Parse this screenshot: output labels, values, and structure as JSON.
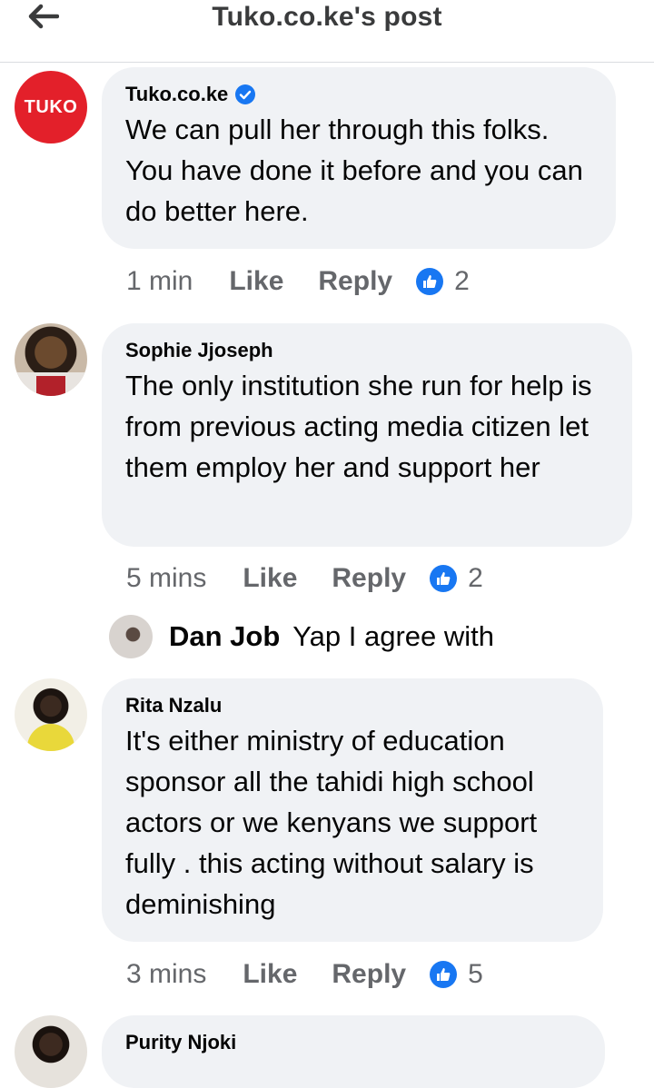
{
  "header": {
    "title": "Tuko.co.ke's post",
    "back_icon": "arrow-left-icon"
  },
  "colors": {
    "accent": "#1877f2",
    "bubble": "#f0f2f5",
    "tuko_red": "#e3202a"
  },
  "comments": [
    {
      "author": "Tuko.co.ke",
      "verified": true,
      "avatar_text": "TUKO",
      "text": "We can pull her through this folks. You have done it before and you can do better here.",
      "time": "1 min",
      "like": "Like",
      "reply": "Reply",
      "reactions": "2"
    },
    {
      "author": "Sophie Jjoseph",
      "text": "The only institution she run for help is from previous acting media citizen let them employ her and support her",
      "time": "5 mins",
      "like": "Like",
      "reply": "Reply",
      "reactions": "2"
    },
    {
      "author": "Rita Nzalu",
      "text": "It's either ministry of education sponsor all the tahidi high school actors or we kenyans we support fully . this acting without salary is deminishing",
      "time": "3 mins",
      "like": "Like",
      "reply": "Reply",
      "reactions": "5"
    },
    {
      "author": "Purity Njoki"
    }
  ],
  "reply_preview": {
    "author": "Dan Job",
    "text": "Yap I agree with"
  }
}
